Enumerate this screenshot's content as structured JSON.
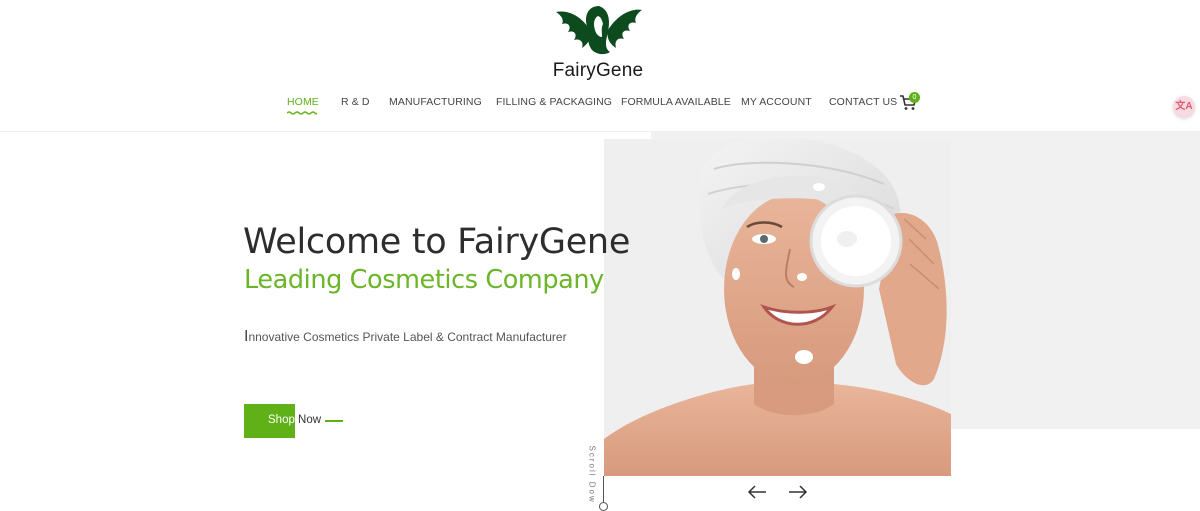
{
  "brand": {
    "name": "FairyGene"
  },
  "nav": {
    "items": [
      {
        "label": "HOME",
        "active": true
      },
      {
        "label": "R & D",
        "active": false
      },
      {
        "label": "MANUFACTURING",
        "active": false
      },
      {
        "label": "FILLING & PACKAGING",
        "active": false
      },
      {
        "label": "FORMULA AVAILABLE",
        "active": false
      },
      {
        "label": "MY ACCOUNT",
        "active": false
      },
      {
        "label": "CONTACT US",
        "active": false
      }
    ],
    "cart": {
      "icon": "cart-icon",
      "count": "0"
    },
    "translate": {
      "icon": "translate-icon",
      "label": "文A"
    }
  },
  "hero": {
    "title": "Welcome to FairyGene",
    "subtitle": "Leading Cosmetics Company",
    "tagline_first": "I",
    "tagline_rest": "nnovative Cosmetics Private Label & Contract Manufacturer",
    "button_label_white": "Shop",
    "button_label_dark": " Now",
    "scroll_label": "Scroll Dow",
    "prev_icon": "arrow-left-icon",
    "next_icon": "arrow-right-icon"
  },
  "colors": {
    "accent": "#5fb117",
    "logo": "#0d4a1e",
    "hero_grey": "#f1f1f1"
  }
}
